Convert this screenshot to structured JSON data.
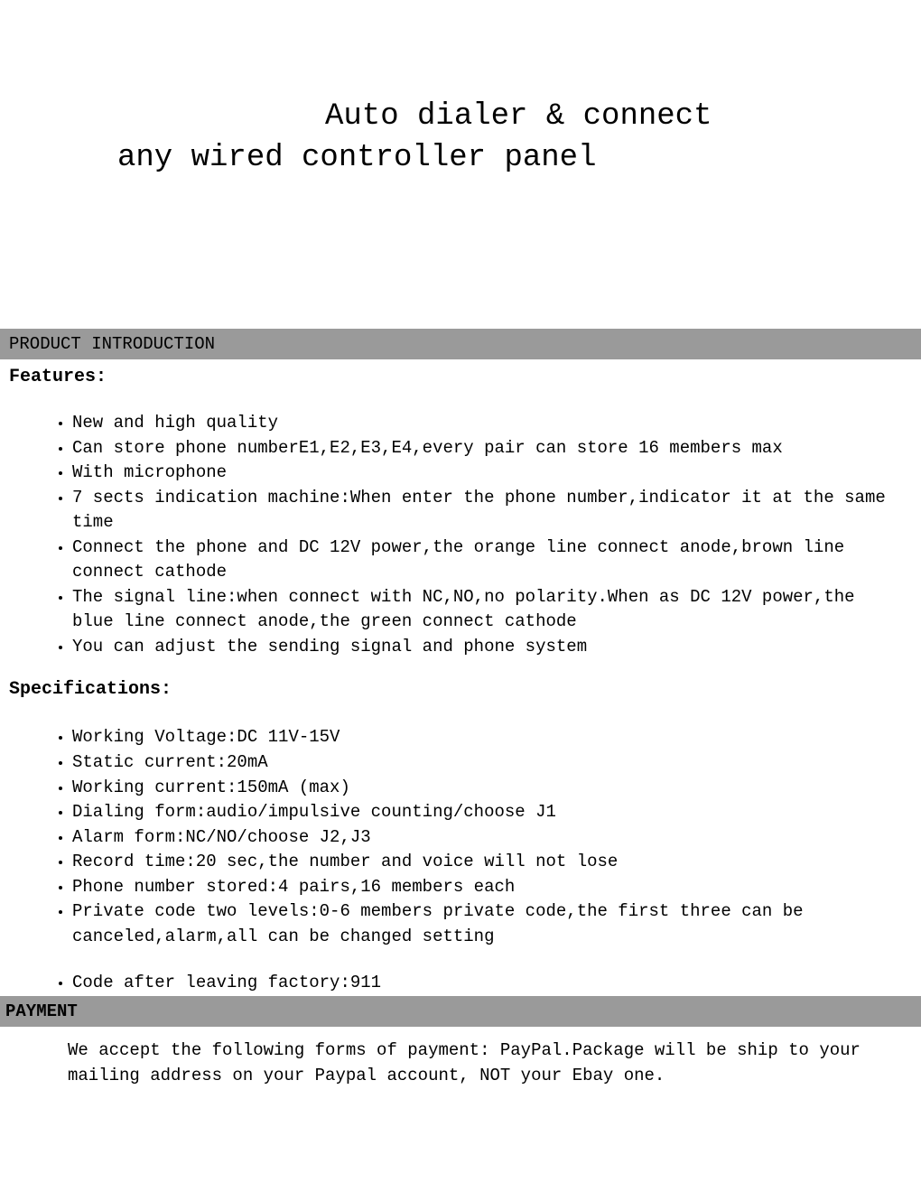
{
  "title": {
    "line1": "Auto dialer & connect",
    "line2": "any wired controller panel"
  },
  "section_intro": "PRODUCT INTRODUCTION",
  "features_heading": "Features:",
  "features": [
    "New and high quality",
    "Can store phone numberE1,E2,E3,E4,every pair can store 16 members max",
    "With microphone",
    "7 sects indication machine:When enter the phone number,indicator it at the same time",
    "Connect the phone and DC 12V power,the orange line connect anode,brown line connect cathode",
    "The signal line:when connect with NC,NO,no polarity.When as DC 12V power,the blue line connect anode,the green connect cathode",
    "You can adjust the sending signal and phone system"
  ],
  "specs_heading": "Specifications:",
  "specs": [
    "Working Voltage:DC 11V-15V",
    "Static current:20mA",
    "Working current:150mA (max)",
    "Dialing form:audio/impulsive counting/choose J1",
    "Alarm form:NC/NO/choose J2,J3",
    "Record time:20 sec,the number and voice will not lose",
    "Phone number stored:4 pairs,16 members each",
    "Private code two levels:0-6 members private code,the first three can be canceled,alarm,all can be changed setting",
    "Code after leaving factory:911"
  ],
  "section_payment": "PAYMENT",
  "payment_body": "We accept the following forms of payment: PayPal.Package will be ship to your mailing address on your Paypal account, NOT your Ebay one."
}
